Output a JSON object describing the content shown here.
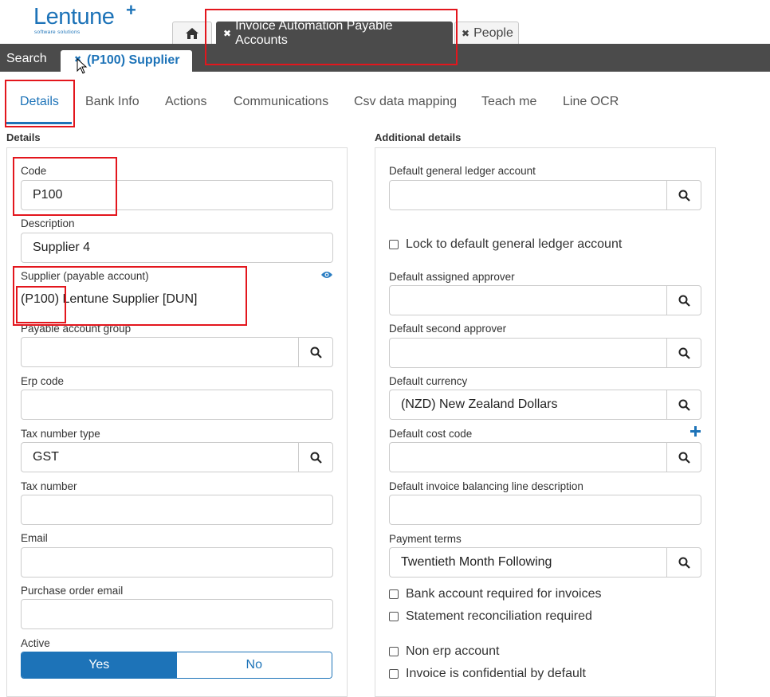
{
  "logo": {
    "name": "Lentune",
    "plus": "+",
    "tagline": "software solutions"
  },
  "app_tabs": [
    {
      "label": "Invoice Automation Payable Accounts",
      "close": "✖"
    },
    {
      "label": "People",
      "close": "✖"
    }
  ],
  "bar": {
    "search_label": "Search",
    "record_tab_label": "(P100) Supplier",
    "record_tab_close": "✖"
  },
  "sub_tabs": [
    "Details",
    "Bank Info",
    "Actions",
    "Communications",
    "Csv data mapping",
    "Teach me",
    "Line OCR"
  ],
  "left": {
    "section_title": "Details",
    "code": {
      "label": "Code",
      "value": "P100"
    },
    "description": {
      "label": "Description",
      "value": "Supplier 4"
    },
    "supplier": {
      "label": "Supplier (payable account)",
      "value": "(P100) Lentune Supplier [DUN]"
    },
    "payable_group": {
      "label": "Payable account group",
      "value": ""
    },
    "erp_code": {
      "label": "Erp code",
      "value": ""
    },
    "tax_type": {
      "label": "Tax number type",
      "value": "GST"
    },
    "tax_number": {
      "label": "Tax number",
      "value": ""
    },
    "email": {
      "label": "Email",
      "value": ""
    },
    "po_email": {
      "label": "Purchase order email",
      "value": ""
    },
    "active": {
      "label": "Active",
      "yes": "Yes",
      "no": "No",
      "selected": "Yes"
    }
  },
  "right": {
    "section_title": "Additional details",
    "default_gl": {
      "label": "Default general ledger account",
      "value": ""
    },
    "lock_gl": {
      "label": "Lock to default general ledger account",
      "checked": false
    },
    "approver": {
      "label": "Default assigned approver",
      "value": ""
    },
    "second_approver": {
      "label": "Default second approver",
      "value": ""
    },
    "currency": {
      "label": "Default currency",
      "value": "(NZD) New Zealand Dollars"
    },
    "cost_code": {
      "label": "Default cost code",
      "value": ""
    },
    "balancing": {
      "label": "Default invoice balancing line description",
      "value": ""
    },
    "payment_terms": {
      "label": "Payment terms",
      "value": "Twentieth Month Following"
    },
    "checks": [
      {
        "label": "Bank account required for invoices",
        "checked": false
      },
      {
        "label": "Statement reconciliation required",
        "checked": false
      },
      {
        "label": "Non erp account",
        "checked": false
      },
      {
        "label": "Invoice is confidential by default",
        "checked": false
      }
    ]
  },
  "colors": {
    "brand": "#1d73b8",
    "bar": "#4b4b4b",
    "highlight": "#e3161d"
  },
  "icons": [
    "home-icon",
    "close-icon",
    "search-icon",
    "eye-icon",
    "plus-icon",
    "cursor-icon"
  ]
}
